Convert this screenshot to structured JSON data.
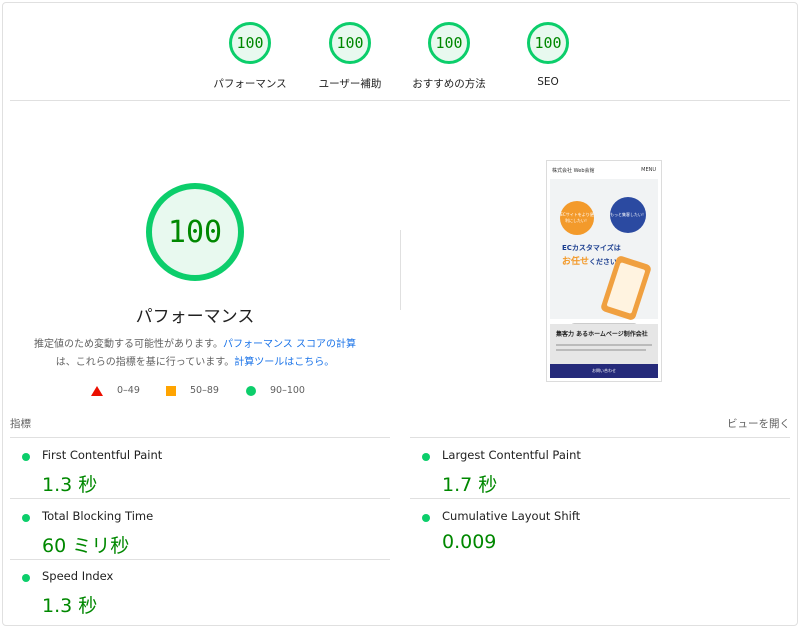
{
  "colors": {
    "pass": "#0cce6b",
    "pass_text": "#008800",
    "average": "#ffa400",
    "fail": "#eb0f00",
    "link": "#1a73e8"
  },
  "gauges": [
    {
      "score": "100",
      "label": "パフォーマンス"
    },
    {
      "score": "100",
      "label": "ユーザー補助"
    },
    {
      "score": "100",
      "label": "おすすめの方法"
    },
    {
      "score": "100",
      "label": "SEO"
    }
  ],
  "main": {
    "score": "100",
    "title": "パフォーマンス",
    "desc_prefix": "推定値のため変動する可能性があります。",
    "desc_link1": "パフォーマンス スコアの計算",
    "desc_middle": "は、これらの指標を基に行っています。",
    "desc_link2": "計算ツールはこちら。"
  },
  "legend": {
    "fail": "0–49",
    "average": "50–89",
    "pass": "90–100"
  },
  "screenshot": {
    "brand": "株式会社 Web会館",
    "menu": "MENU",
    "bubble1": "ECサイトをより便利にしたい！",
    "bubble2": "もっと集客したい！",
    "headline1": "ECカスタマイズは",
    "headline2_strong": "お任せ",
    "headline2_rest": "ください",
    "section_title": "集客力 あるホームページ制作会社",
    "cta": "お問い合わせ"
  },
  "metrics": {
    "title": "指標",
    "toggle": "ビューを開く",
    "items": [
      {
        "name": "First Contentful Paint",
        "value": "1.3 秒"
      },
      {
        "name": "Largest Contentful Paint",
        "value": "1.7 秒"
      },
      {
        "name": "Total Blocking Time",
        "value": "60 ミリ秒"
      },
      {
        "name": "Cumulative Layout Shift",
        "value": "0.009"
      },
      {
        "name": "Speed Index",
        "value": "1.3 秒"
      }
    ]
  }
}
